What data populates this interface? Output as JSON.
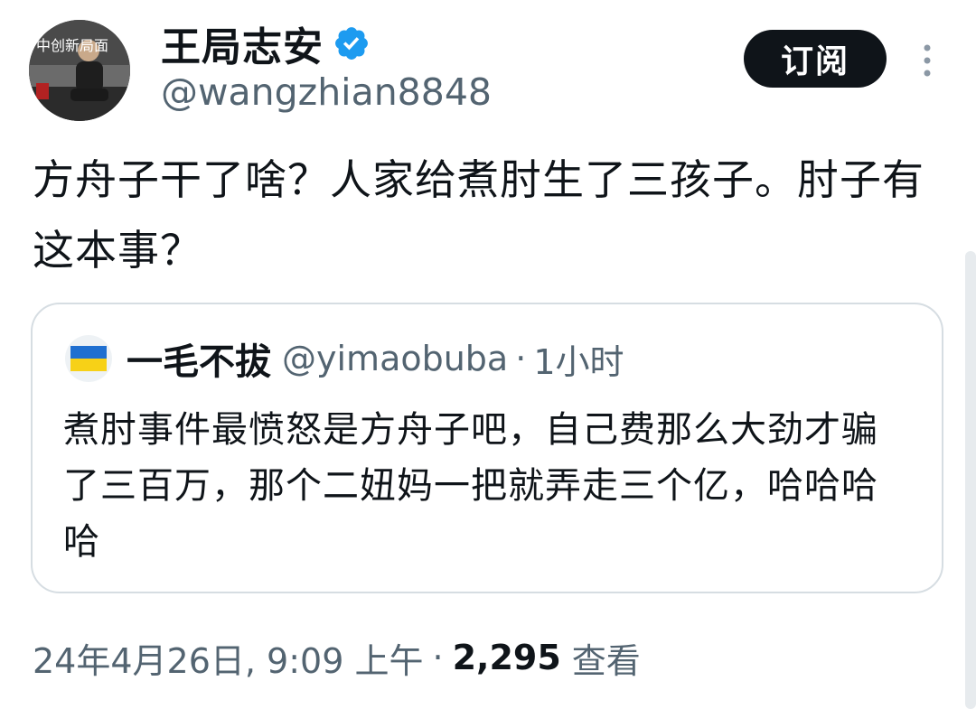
{
  "author": {
    "display_name": "王局志安",
    "handle": "@wangzhian8848",
    "verified_icon": "verified-badge-icon",
    "avatar_icon": "avatar-photo",
    "avatar_text": "中创新局面"
  },
  "actions": {
    "subscribe_label": "订阅",
    "more_icon": "more-vertical-icon"
  },
  "tweet": {
    "text": "方舟子干了啥？人家给煮肘生了三孩子。肘子有这本事？"
  },
  "quote": {
    "flag_icon": "ukraine-flag-icon",
    "display_name": "一毛不拔",
    "handle": "@yimaobuba",
    "separator": "·",
    "time": "1小时",
    "text": "煮肘事件最愤怒是方舟子吧，自己费那么大劲才骗了三百万，那个二妞妈一把就弄走三个亿，哈哈哈哈"
  },
  "meta": {
    "date": "24年4月26日, 9:09 上午",
    "separator": "·",
    "view_count": "2,295",
    "views_label": "查看"
  },
  "colors": {
    "text_primary": "#0f1419",
    "text_secondary": "#536471",
    "verified_blue": "#1d9bf0",
    "border": "#d6dde2"
  }
}
